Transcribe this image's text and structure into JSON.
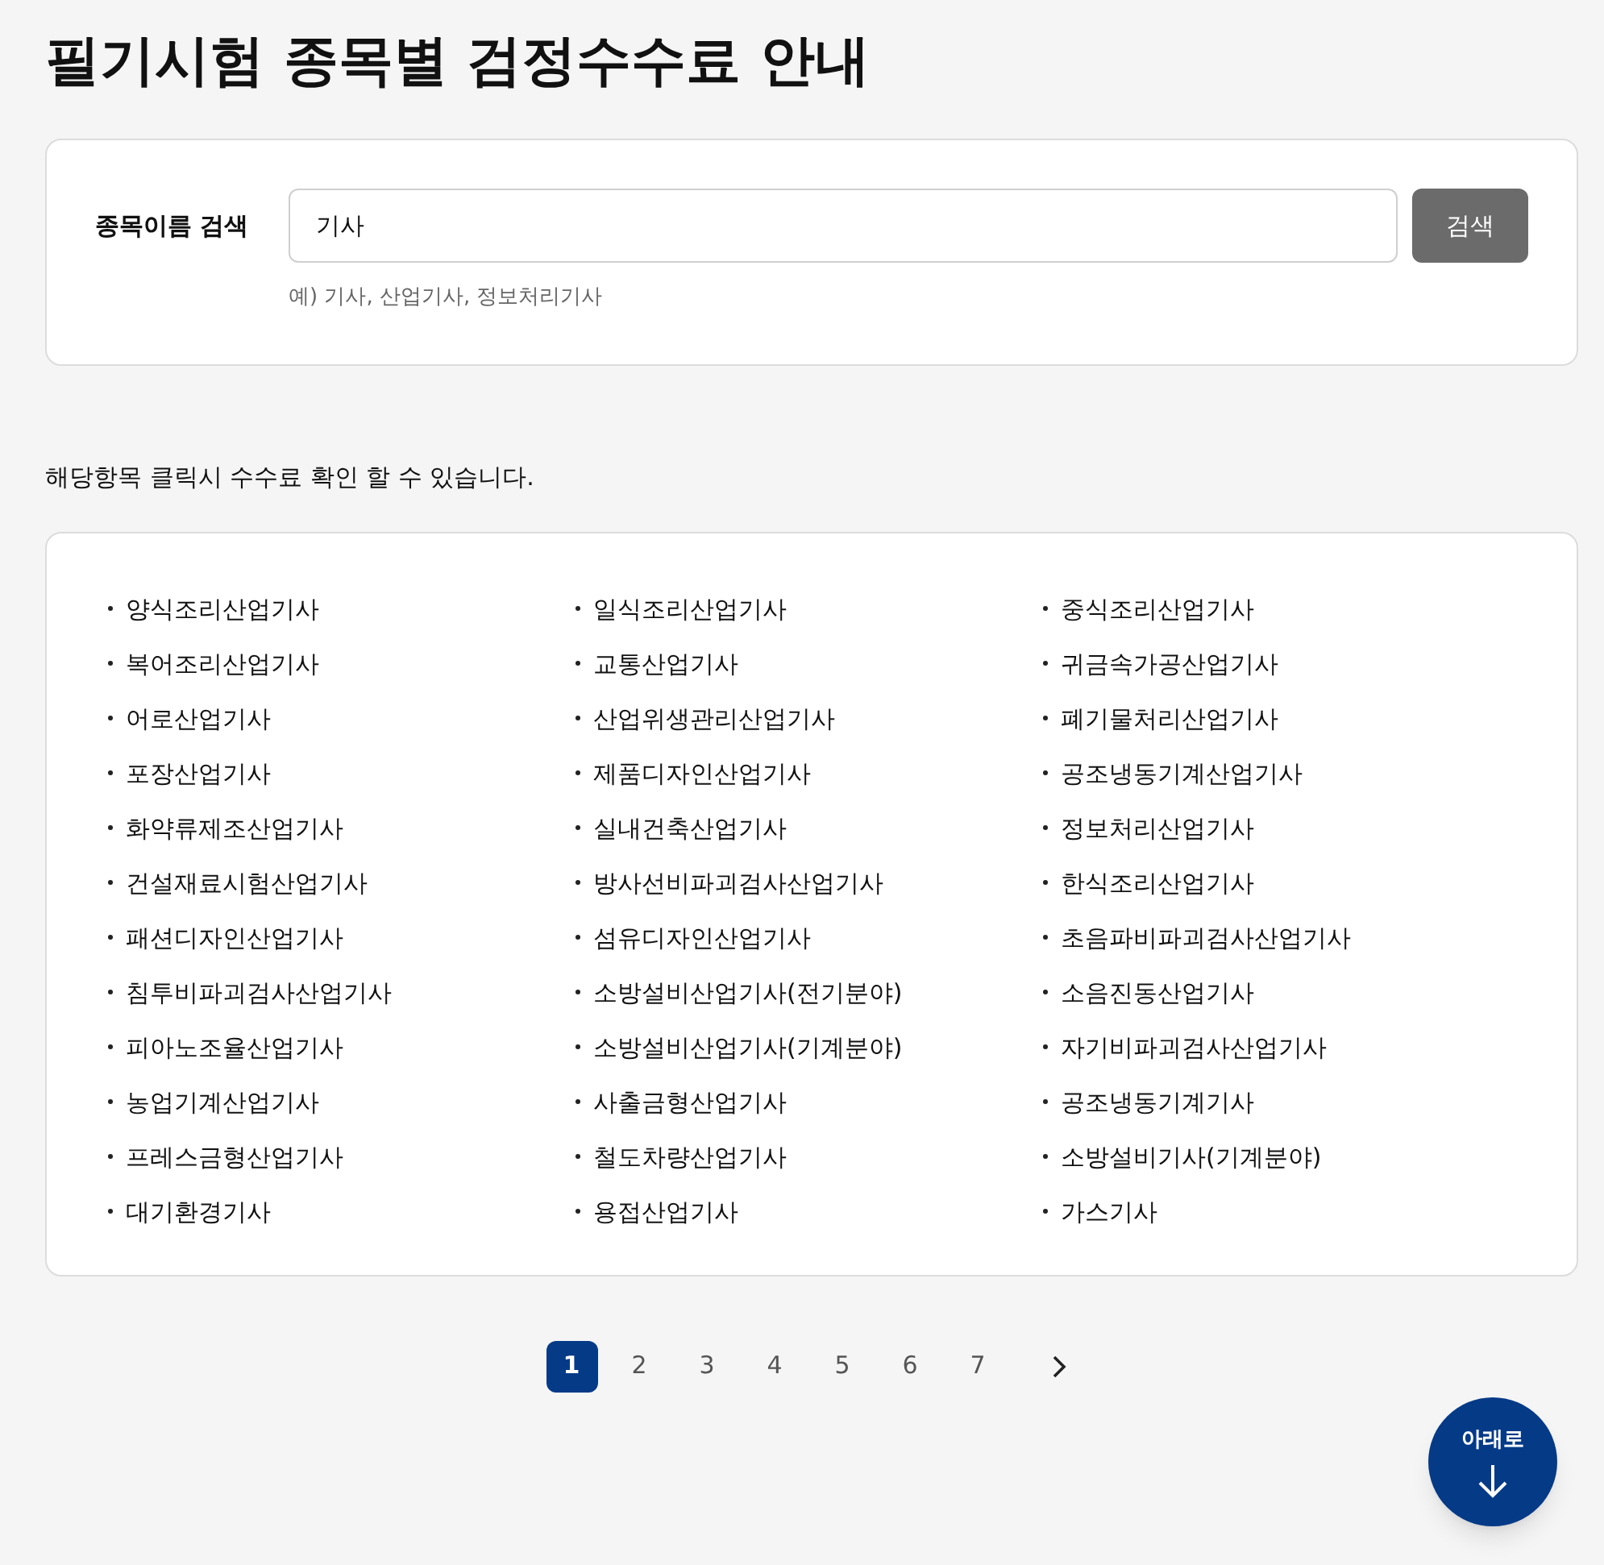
{
  "title": "필기시험 종목별 검정수수료 안내",
  "search": {
    "label": "종목이름 검색",
    "value": "기사",
    "button": "검색",
    "hint": "예) 기사, 산업기사, 정보처리기사"
  },
  "notice": "해당항목 클릭시 수수료 확인 할 수 있습니다.",
  "items": [
    "양식조리산업기사",
    "일식조리산업기사",
    "중식조리산업기사",
    "복어조리산업기사",
    "교통산업기사",
    "귀금속가공산업기사",
    "어로산업기사",
    "산업위생관리산업기사",
    "폐기물처리산업기사",
    "포장산업기사",
    "제품디자인산업기사",
    "공조냉동기계산업기사",
    "화약류제조산업기사",
    "실내건축산업기사",
    "정보처리산업기사",
    "건설재료시험산업기사",
    "방사선비파괴검사산업기사",
    "한식조리산업기사",
    "패션디자인산업기사",
    "섬유디자인산업기사",
    "초음파비파괴검사산업기사",
    "침투비파괴검사산업기사",
    "소방설비산업기사(전기분야)",
    "소음진동산업기사",
    "피아노조율산업기사",
    "소방설비산업기사(기계분야)",
    "자기비파괴검사산업기사",
    "농업기계산업기사",
    "사출금형산업기사",
    "공조냉동기계기사",
    "프레스금형산업기사",
    "철도차량산업기사",
    "소방설비기사(기계분야)",
    "대기환경기사",
    "용접산업기사",
    "가스기사"
  ],
  "pagination": [
    {
      "label": "1",
      "selected": true
    },
    {
      "label": "2",
      "selected": false
    },
    {
      "label": "3",
      "selected": false
    },
    {
      "label": "4",
      "selected": false
    },
    {
      "label": "5",
      "selected": false
    },
    {
      "label": "6",
      "selected": false
    },
    {
      "label": "7",
      "selected": false
    }
  ],
  "fab": {
    "label": "아래로"
  }
}
